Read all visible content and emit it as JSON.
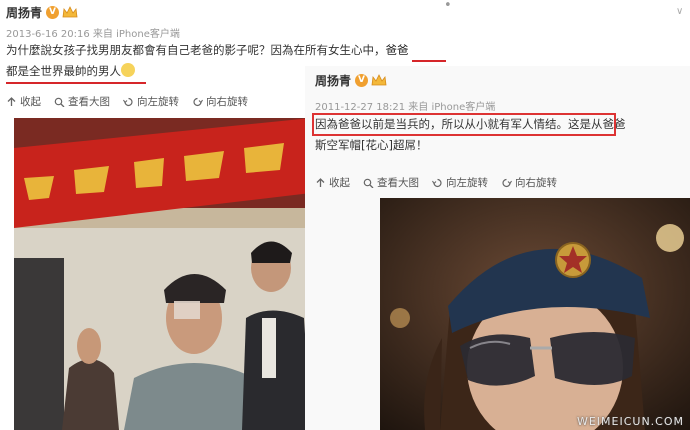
{
  "post1": {
    "author": "周扬青",
    "badge": "V",
    "meta": "2013-6-16 20:16 来自 iPhone客户端",
    "line1_a": "为什麼說女孩子找男朋友都會有自己老爸的影子呢？因為在所有女生心中，",
    "line1_b": "爸爸",
    "line2": "都是全世界最帥的男人",
    "toolbar": [
      "收起",
      "查看大图",
      "向左旋转",
      "向右旋转"
    ]
  },
  "post2": {
    "author": "周扬青",
    "badge": "V",
    "meta": "2011-12-27 18:21 来自 iPhone客户端",
    "line1_a": "因為爸爸以前是当兵的，所以从小就有军人情结。",
    "line1_b": "这是从爸爸",
    "line2": "斯空军帽[花心]超屌！",
    "toolbar": [
      "收起",
      "查看大图",
      "向左旋转",
      "向右旋转"
    ]
  },
  "watermark": "WEIMEICUN.COM",
  "colors": {
    "highlight": "#d6262a",
    "badge": "#f0a030",
    "meta": "#999999"
  }
}
